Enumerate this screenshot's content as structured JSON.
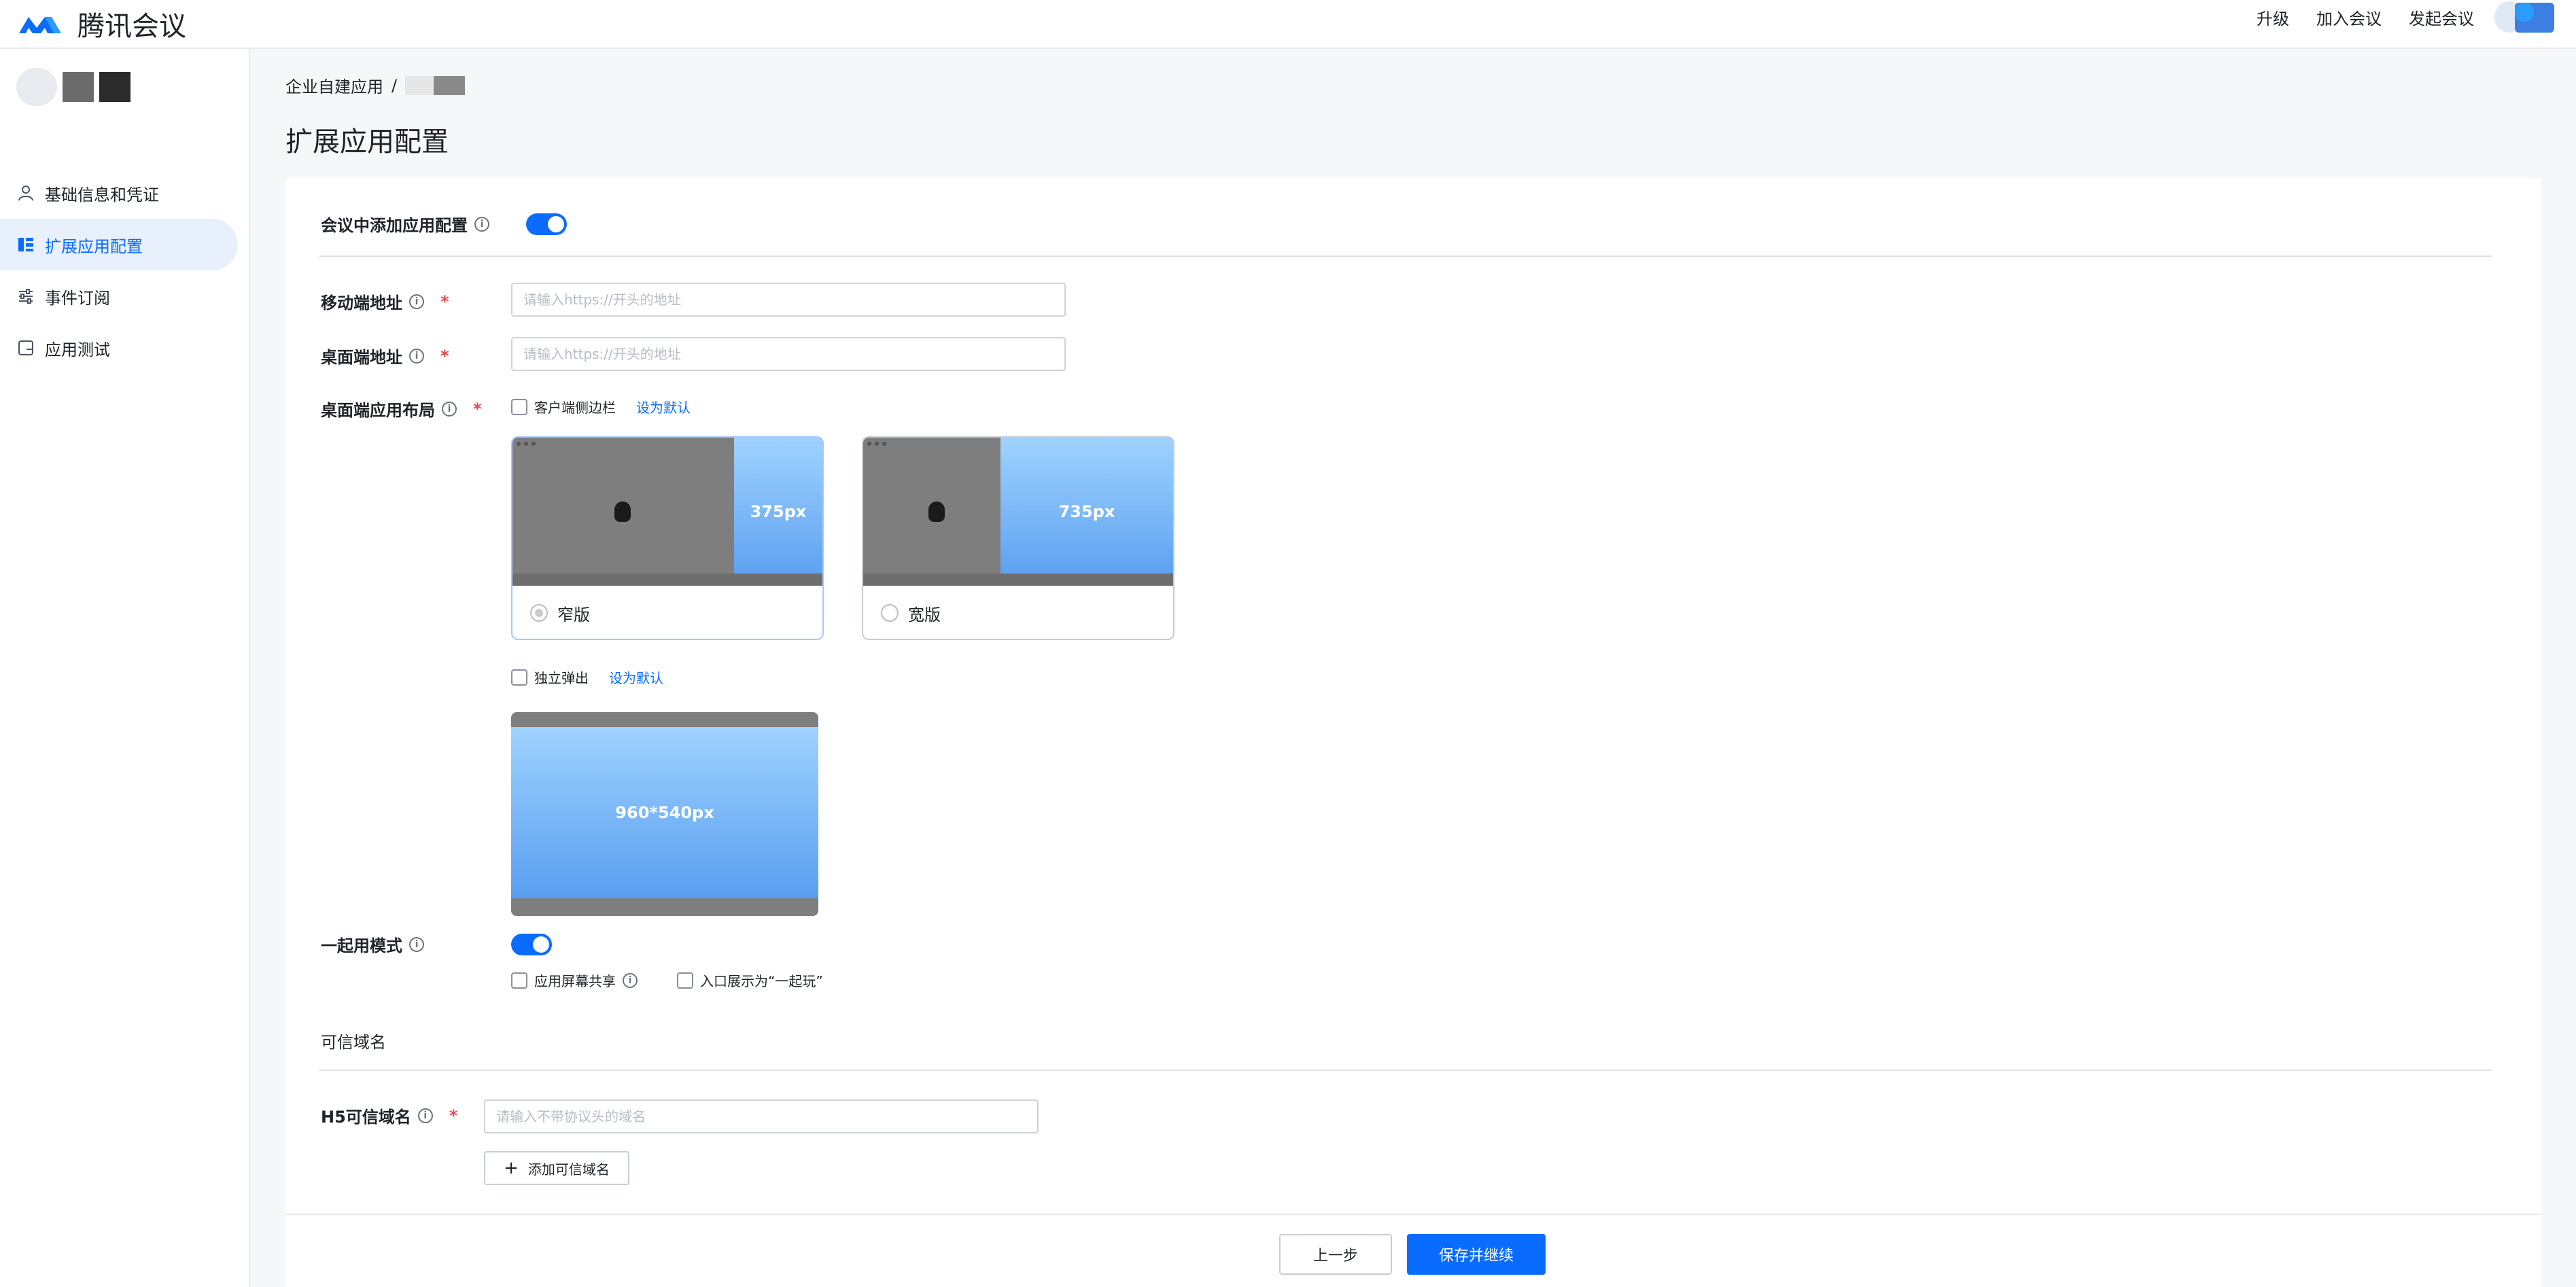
{
  "header": {
    "brand": "腾讯会议",
    "nav": [
      "升级",
      "加入会议",
      "发起会议"
    ]
  },
  "sidebar": {
    "items": [
      {
        "label": "基础信息和凭证",
        "icon": "user-icon"
      },
      {
        "label": "扩展应用配置",
        "icon": "grid-list-icon",
        "active": true
      },
      {
        "label": "事件订阅",
        "icon": "sliders-icon"
      },
      {
        "label": "应用测试",
        "icon": "test-icon"
      }
    ]
  },
  "breadcrumb": {
    "root": "企业自建应用",
    "sep": "/"
  },
  "page": {
    "title": "扩展应用配置"
  },
  "form": {
    "add_app_label": "会议中添加应用配置",
    "mobile_label": "移动端地址",
    "mobile_placeholder": "请输入https://开头的地址",
    "desktop_label": "桌面端地址",
    "desktop_placeholder": "请输入https://开头的地址",
    "layout_label": "桌面端应用布局",
    "sidebar_option": "客户端侧边栏",
    "set_default": "设为默认",
    "narrow_size": "375px",
    "narrow_label": "窄版",
    "wide_size": "735px",
    "wide_label": "宽版",
    "popup_option": "独立弹出",
    "popup_size": "960*540px",
    "together_label": "一起用模式",
    "share_screen": "应用屏幕共享",
    "entry_play": "入口展示为“一起玩”",
    "trusted_section": "可信域名",
    "h5_label": "H5可信域名",
    "h5_placeholder": "请输入不带协议头的域名",
    "add_domain": "添加可信域名"
  },
  "footer": {
    "prev": "上一步",
    "save": "保存并继续"
  },
  "colors": {
    "accent": "#0a6cff",
    "required": "#e5484d"
  }
}
